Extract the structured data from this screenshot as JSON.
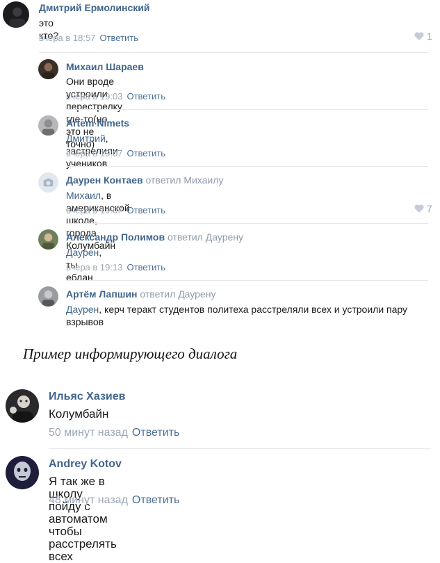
{
  "thread1": {
    "comments": [
      {
        "author": "Дмитрий Ермолинский",
        "text": "это кто?",
        "time": "вчера в 18:57",
        "reply": "Ответить",
        "likes": "1"
      },
      {
        "author": "Михаил Шараев",
        "text": "Они вроде устроили перестрелку где-то(но это не точно)",
        "time": "вчера в 19:03",
        "reply": "Ответить"
      },
      {
        "author": "Artem Nimets",
        "text_mention": "Дмитрий",
        "text": ", застрелили учеников",
        "time": "вчера в 19:07",
        "reply": "Ответить"
      },
      {
        "author": "Даурен Контаев",
        "replied_to": "ответил Михаилу",
        "text_mention": "Михаил",
        "text": ", в американской школе, города Колумбайн",
        "time": "вчера в 19:07",
        "reply": "Ответить",
        "likes": "7"
      },
      {
        "author": "Александр Полимов",
        "replied_to": "ответил Даурену",
        "text_mention": "Даурен",
        "text": ", ты еблан",
        "time": "вчера в 19:13",
        "reply": "Ответить"
      },
      {
        "author": "Артём Лапшин",
        "replied_to": "ответил Даурену",
        "text_mention": "Даурен",
        "text": ", керч теракт студентов политеха расстреляли всех и устроили пару взрывов"
      }
    ]
  },
  "caption": "Пример информирующего диалога",
  "thread2": {
    "comments": [
      {
        "author": "Ильяс Хазиев",
        "text": "Колумбайн",
        "time": "50 минут назад",
        "reply": "Ответить"
      },
      {
        "author": "Andrey Kotov",
        "text": "Я так же в школу пойду с автоматом чтобы расстрелять всех",
        "time": "48 минут назад",
        "reply": "Ответить"
      }
    ]
  },
  "colors": {
    "author": "#41658c",
    "meta": "#9aa7b5",
    "reply_link": "#4b6f95",
    "separator": "#e7e8ec"
  },
  "icons": {
    "like": "heart-icon",
    "no_avatar": "camera-icon"
  }
}
